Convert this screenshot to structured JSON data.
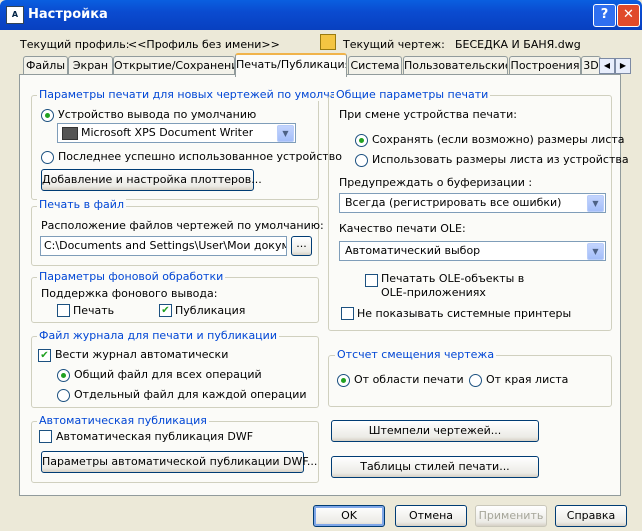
{
  "window": {
    "title": "Настройка",
    "help": "?",
    "close": "✕",
    "app_icon": "A"
  },
  "profile": {
    "label": "Текущий профиль:",
    "value": "<<Профиль без имени>>",
    "drawing_label": "Текущий чертеж:",
    "drawing_value": "БЕСЕДКА И БАНЯ.dwg"
  },
  "tabs": [
    "Файлы",
    "Экран",
    "Открытие/Сохранение",
    "Печать/Публикация",
    "Система",
    "Пользовательские",
    "Построения",
    "3D"
  ],
  "tab_scroll": {
    "left": "◀",
    "right": "▶"
  },
  "default_print": {
    "title": "Параметры печати для новых чертежей по умолчанию",
    "device_radio": "Устройство вывода по умолчанию",
    "device_value": "Microsoft XPS Document Writer",
    "last_used_radio": "Последнее успешно использованное устройство",
    "plotters_button": "Добавление и настройка плоттеров..."
  },
  "print_to_file": {
    "title": "Печать в файл",
    "location_label": "Расположение файлов чертежей по умолчанию:",
    "path": "C:\\Documents and Settings\\User\\Мои документ",
    "browse": "..."
  },
  "background": {
    "title": "Параметры фоновой обработки",
    "support_label": "Поддержка фонового вывода:",
    "print": "Печать",
    "publish": "Публикация"
  },
  "log": {
    "title": "Файл журнала для печати и публикации",
    "auto_log": "Вести журнал автоматически",
    "shared": "Общий файл для всех операций",
    "separate": "Отдельный файл для каждой операции"
  },
  "autopublish": {
    "title": "Автоматическая публикация",
    "checkbox": "Автоматическая публикация DWF",
    "button": "Параметры автоматической публикации DWF..."
  },
  "general": {
    "title": "Общие параметры печати",
    "on_change_label": "При смене устройства печати:",
    "keep_size": "Сохранять (если возможно) размеры листа",
    "use_device_size": "Использовать размеры листа из устройства",
    "spool_label": "Предупреждать о буферизации :",
    "spool_value": "Всегда (регистрировать все ошибки)",
    "ole_label": "Качество печати OLE:",
    "ole_value": "Автоматический выбор",
    "ole_print_1": "Печатать OLE-объекты в",
    "ole_print_2": "OLE-приложениях",
    "hide_system": "Не показывать системные принтеры"
  },
  "offset": {
    "title": "Отсчет смещения чертежа",
    "from_area": "От области печати",
    "from_edge": "От края листа"
  },
  "side_buttons": {
    "stamps": "Штемпели чертежей...",
    "styles": "Таблицы стилей печати..."
  },
  "footer": {
    "ok": "OK",
    "cancel": "Отмена",
    "apply": "Применить",
    "help": "Справка"
  },
  "checkmark": "✔",
  "arrow": "▼",
  "colors": {
    "accent": "#0046d5",
    "titlebar": "#0a4bd0",
    "check": "#21a121"
  }
}
